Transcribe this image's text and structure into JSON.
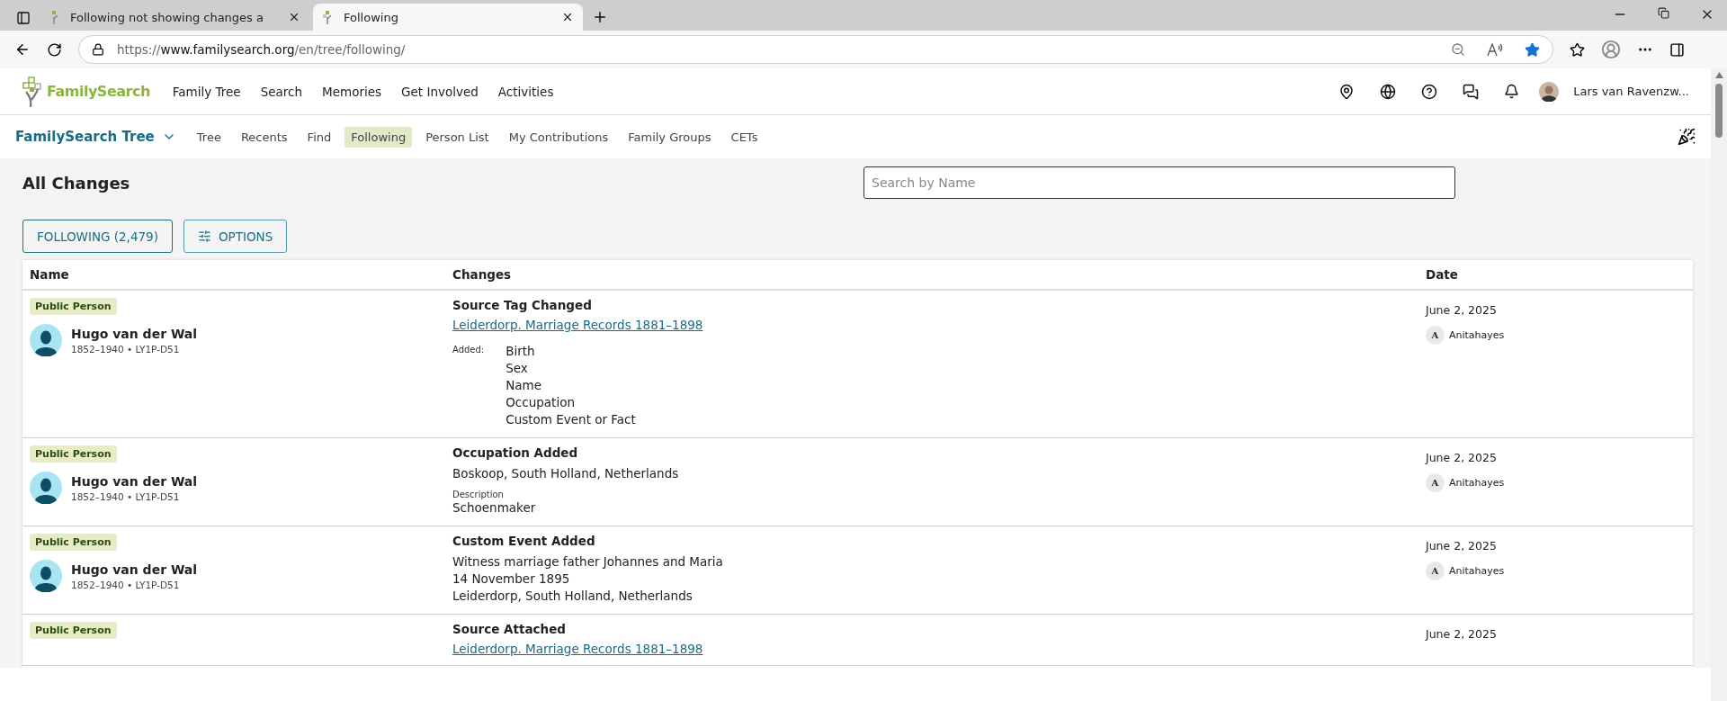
{
  "browser": {
    "tabs": [
      {
        "title": "Following not showing changes a",
        "selected": false
      },
      {
        "title": "Following",
        "selected": true
      }
    ],
    "url": {
      "scheme": "https://",
      "host": "www.familysearch.org",
      "path": "/en/tree/following/"
    }
  },
  "site_header": {
    "logo": "FamilySearch",
    "nav": [
      "Family Tree",
      "Search",
      "Memories",
      "Get Involved",
      "Activities"
    ],
    "user": "Lars van Ravenzw..."
  },
  "subnav": {
    "title": "FamilySearch Tree",
    "items": [
      {
        "label": "Tree",
        "selected": false
      },
      {
        "label": "Recents",
        "selected": false
      },
      {
        "label": "Find",
        "selected": false
      },
      {
        "label": "Following",
        "selected": true
      },
      {
        "label": "Person List",
        "selected": false
      },
      {
        "label": "My Contributions",
        "selected": false
      },
      {
        "label": "Family Groups",
        "selected": false
      },
      {
        "label": "CETs",
        "selected": false
      }
    ]
  },
  "page": {
    "title": "All Changes",
    "search": {
      "placeholder": "Search by Name"
    },
    "buttons": [
      {
        "kind": "following",
        "label": "FOLLOWING (2,479)"
      },
      {
        "kind": "options",
        "label": "OPTIONS"
      }
    ]
  },
  "table": {
    "columns": [
      "Name",
      "Changes",
      "Date"
    ],
    "rows": [
      {
        "badge": "Public Person",
        "name": "Hugo van der Wal",
        "meta": "1852–1940 • LY1P-D51",
        "change": "Source Tag Changed",
        "details": [
          {
            "kind": "link",
            "text": "Leiderdorp. Marriage Records 1881–1898"
          },
          {
            "kind": "added",
            "label": "Added:",
            "items": [
              "Birth",
              "Sex",
              "Name",
              "Occupation",
              "Custom Event or Fact"
            ]
          }
        ],
        "date": "June 2, 2025",
        "contributor": {
          "initial": "A",
          "name": "Anitahayes"
        }
      },
      {
        "badge": "Public Person",
        "name": "Hugo van der Wal",
        "meta": "1852–1940 • LY1P-D51",
        "change": "Occupation Added",
        "details": [
          {
            "kind": "text",
            "lines": [
              "Boskoop, South Holland, Netherlands"
            ]
          },
          {
            "kind": "labeled",
            "label": "Description",
            "value": "Schoenmaker"
          }
        ],
        "date": "June 2, 2025",
        "contributor": {
          "initial": "A",
          "name": "Anitahayes"
        }
      },
      {
        "badge": "Public Person",
        "name": "Hugo van der Wal",
        "meta": "1852–1940 • LY1P-D51",
        "change": "Custom Event Added",
        "details": [
          {
            "kind": "text",
            "lines": [
              "Witness marriage father Johannes and Maria",
              "14 November 1895",
              "Leiderdorp, South Holland, Netherlands"
            ]
          }
        ],
        "date": "June 2, 2025",
        "contributor": {
          "initial": "A",
          "name": "Anitahayes"
        }
      },
      {
        "badge": "Public Person",
        "change": "Source Attached",
        "details": [
          {
            "kind": "link",
            "text": "Leiderdorp. Marriage Records 1881–1898"
          }
        ],
        "date": "June 2, 2025"
      }
    ]
  }
}
